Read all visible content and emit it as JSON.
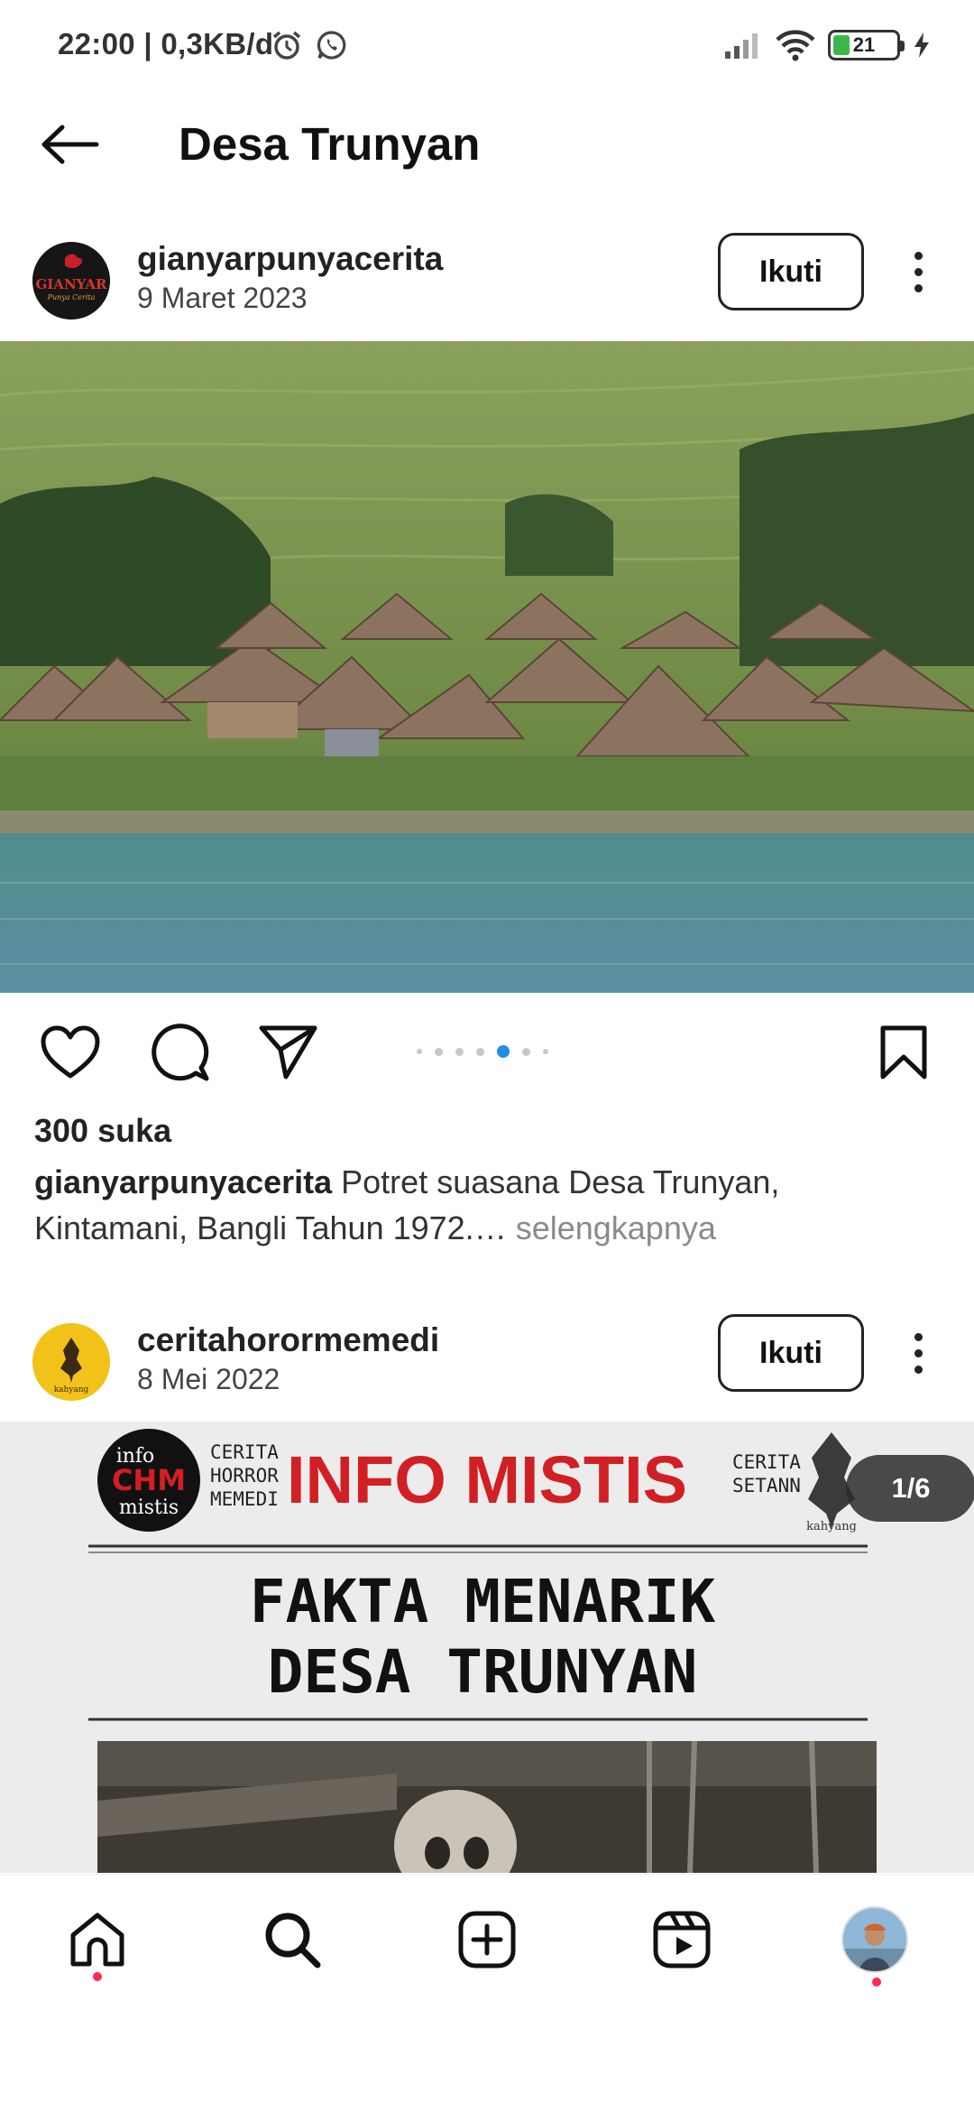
{
  "status_bar": {
    "time": "22:00",
    "net_speed": "| 0,3KB/d",
    "battery_level": "21"
  },
  "header": {
    "title": "Desa Trunyan"
  },
  "posts": [
    {
      "username": "gianyarpunyacerita",
      "date": "9 Maret 2023",
      "follow_label": "Ikuti",
      "avatar_text": "GIANYAR",
      "avatar_subtext": "Punya Cerita",
      "likes": "300 suka",
      "caption_user": "gianyarpunyacerita",
      "caption_text": " Potret suasana Desa Trunyan, Kintamani, Bangli Tahun 1972.…",
      "caption_more": " selengkapnya",
      "carousel_active_index": 4,
      "carousel_count": 7
    },
    {
      "username": "ceritahorormemedi",
      "date": "8 Mei 2022",
      "follow_label": "Ikuti",
      "avatar_text": "kahyang",
      "page_counter": "1/6",
      "image": {
        "logo_top": "info",
        "logo_mid": "CHM",
        "logo_bottom": "mistis",
        "side_left_1": "CERITA",
        "side_left_2": "HORROR",
        "side_left_3": "MEMEDI",
        "banner": "INFO MISTIS",
        "side_right_1": "CERITA",
        "side_right_2": "SETANN",
        "side_right_brand": "kahyang",
        "headline_1": "FAKTA MENARIK",
        "headline_2": "DESA TRUNYAN"
      }
    }
  ],
  "colors": {
    "accent_blue": "#1f8fe8",
    "notification_red": "#ff2a4f",
    "banner_red": "#d11f24"
  },
  "icons": {
    "back": "arrow-left-icon",
    "like": "heart-icon",
    "comment": "comment-icon",
    "share": "send-icon",
    "save": "bookmark-icon",
    "home": "home-icon",
    "search": "search-icon",
    "create": "add-post-icon",
    "reels": "reels-icon",
    "profile": "profile-avatar"
  }
}
